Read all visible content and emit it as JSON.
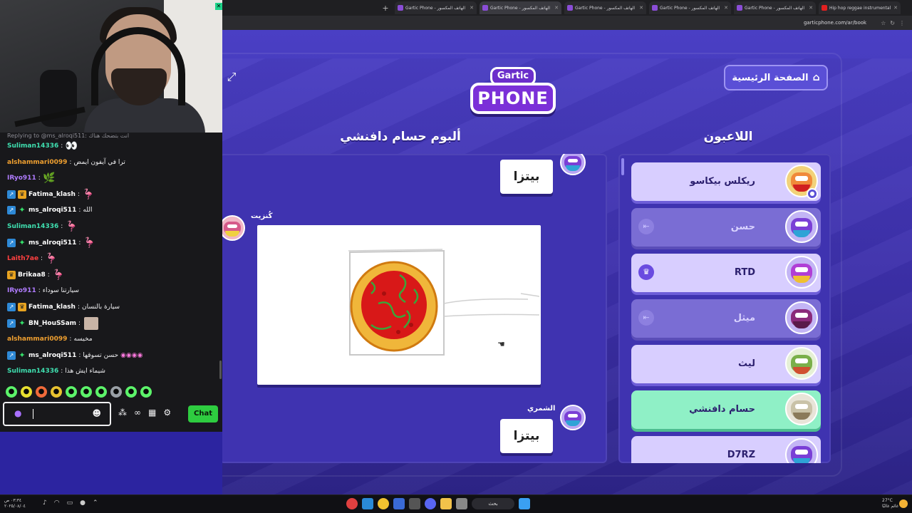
{
  "browser": {
    "tabs": [
      "Gartic Phone - الهاتف المكسور",
      "Gartic Phone - الهاتف المكسور",
      "Gartic Phone - الهاتف المكسور",
      "Gartic Phone - الهاتف المكسور",
      "Gartic Phone - الهاتف المكسور",
      "Hip hop reggae instrumental"
    ],
    "new_tab": "+",
    "url": "garticphone.com/ar/book"
  },
  "game": {
    "logo_top": "Gartic",
    "logo_bottom": "PHONE",
    "home_label": "الصفحة الرئيسية",
    "album_title": "ألبوم حسام دافنشي",
    "players_title": "اللاعبون",
    "album": {
      "entry1_text": "بيتزا",
      "entry2_author": "كُنزيت",
      "entry3_author": "الشمري",
      "entry3_text": "بيتزا"
    },
    "players": [
      {
        "name": "ريكلس بيكاسو",
        "state": "normal",
        "host": true
      },
      {
        "name": "حسن",
        "state": "dim",
        "icon": "⇤"
      },
      {
        "name": "RTD",
        "state": "normal",
        "icon": "♛"
      },
      {
        "name": "ميثل",
        "state": "dim",
        "icon": "⇤"
      },
      {
        "name": "ليث",
        "state": "normal"
      },
      {
        "name": "حسام دافنشي",
        "state": "current"
      },
      {
        "name": "D7RZ",
        "state": "normal"
      }
    ]
  },
  "chat": {
    "reply_line": "Replying to @ms_alroqi511: انت بتضحك هناك",
    "messages": [
      {
        "user": "Suliman14336",
        "color": "#3fe0b0",
        "text": "",
        "emote": "👀",
        "badges": []
      },
      {
        "user": "alshammari0099",
        "color": "#f0a030",
        "text": "ترا في آيفون ايمض",
        "emote": "",
        "badges": []
      },
      {
        "user": "IRyo911",
        "color": "#b07cff",
        "text": "",
        "emote": "🌿",
        "badges": []
      },
      {
        "user": "Fatima_klash",
        "color": "#ffffff",
        "text": "",
        "emote": "🦩",
        "badges": [
          "b1",
          "b2"
        ]
      },
      {
        "user": "ms_alroqi511",
        "color": "#ffffff",
        "text": "الله",
        "emote": "",
        "badges": [
          "b1",
          "b3"
        ]
      },
      {
        "user": "Suliman14336",
        "color": "#3fe0b0",
        "text": "",
        "emote": "🦩",
        "badges": []
      },
      {
        "user": "ms_alroqi511",
        "color": "#ffffff",
        "text": "",
        "emote": "🦩",
        "badges": [
          "b1",
          "b3"
        ]
      },
      {
        "user": "Laith7ae",
        "color": "#ff4040",
        "text": "",
        "emote": "🦩",
        "badges": []
      },
      {
        "user": "Brikaa8",
        "color": "#ffffff",
        "text": "",
        "emote": "🦩",
        "badges": [
          "b2"
        ]
      },
      {
        "user": "IRyo911",
        "color": "#b07cff",
        "text": "سيارتنا سوداء",
        "emote": "",
        "badges": []
      },
      {
        "user": "Fatima_klash",
        "color": "#ffffff",
        "text": "سيارة بالنسان",
        "emote": "",
        "badges": [
          "b1",
          "b2"
        ]
      },
      {
        "user": "BN_HouSSam",
        "color": "#ffffff",
        "text": "",
        "emote": "face",
        "badges": [
          "b1",
          "b3"
        ]
      },
      {
        "user": "alshammari0099",
        "color": "#f0a030",
        "text": "مخيسه",
        "emote": "",
        "badges": []
      },
      {
        "user": "ms_alroqi511",
        "color": "#ffffff",
        "text": "حسن تسوقها",
        "emote": "◉◉◉◉",
        "badges": [
          "b1",
          "b3"
        ]
      },
      {
        "user": "Suliman14336",
        "color": "#3fe0b0",
        "text": "شيماء ايش هذا",
        "emote": "",
        "badges": []
      }
    ],
    "input_placeholder": "",
    "send_label": "Chat",
    "emote_bar": [
      "●",
      "●",
      "●",
      "●",
      "●",
      "●",
      "●",
      "●",
      "●",
      "●"
    ]
  },
  "taskbar": {
    "time": "٠٣:٣٤ ص",
    "date": "٢٠٢٥/٠٨/٠٤",
    "search_label": "بحث",
    "weather_temp": "27°C",
    "weather_label": "غائم غالبًا"
  }
}
